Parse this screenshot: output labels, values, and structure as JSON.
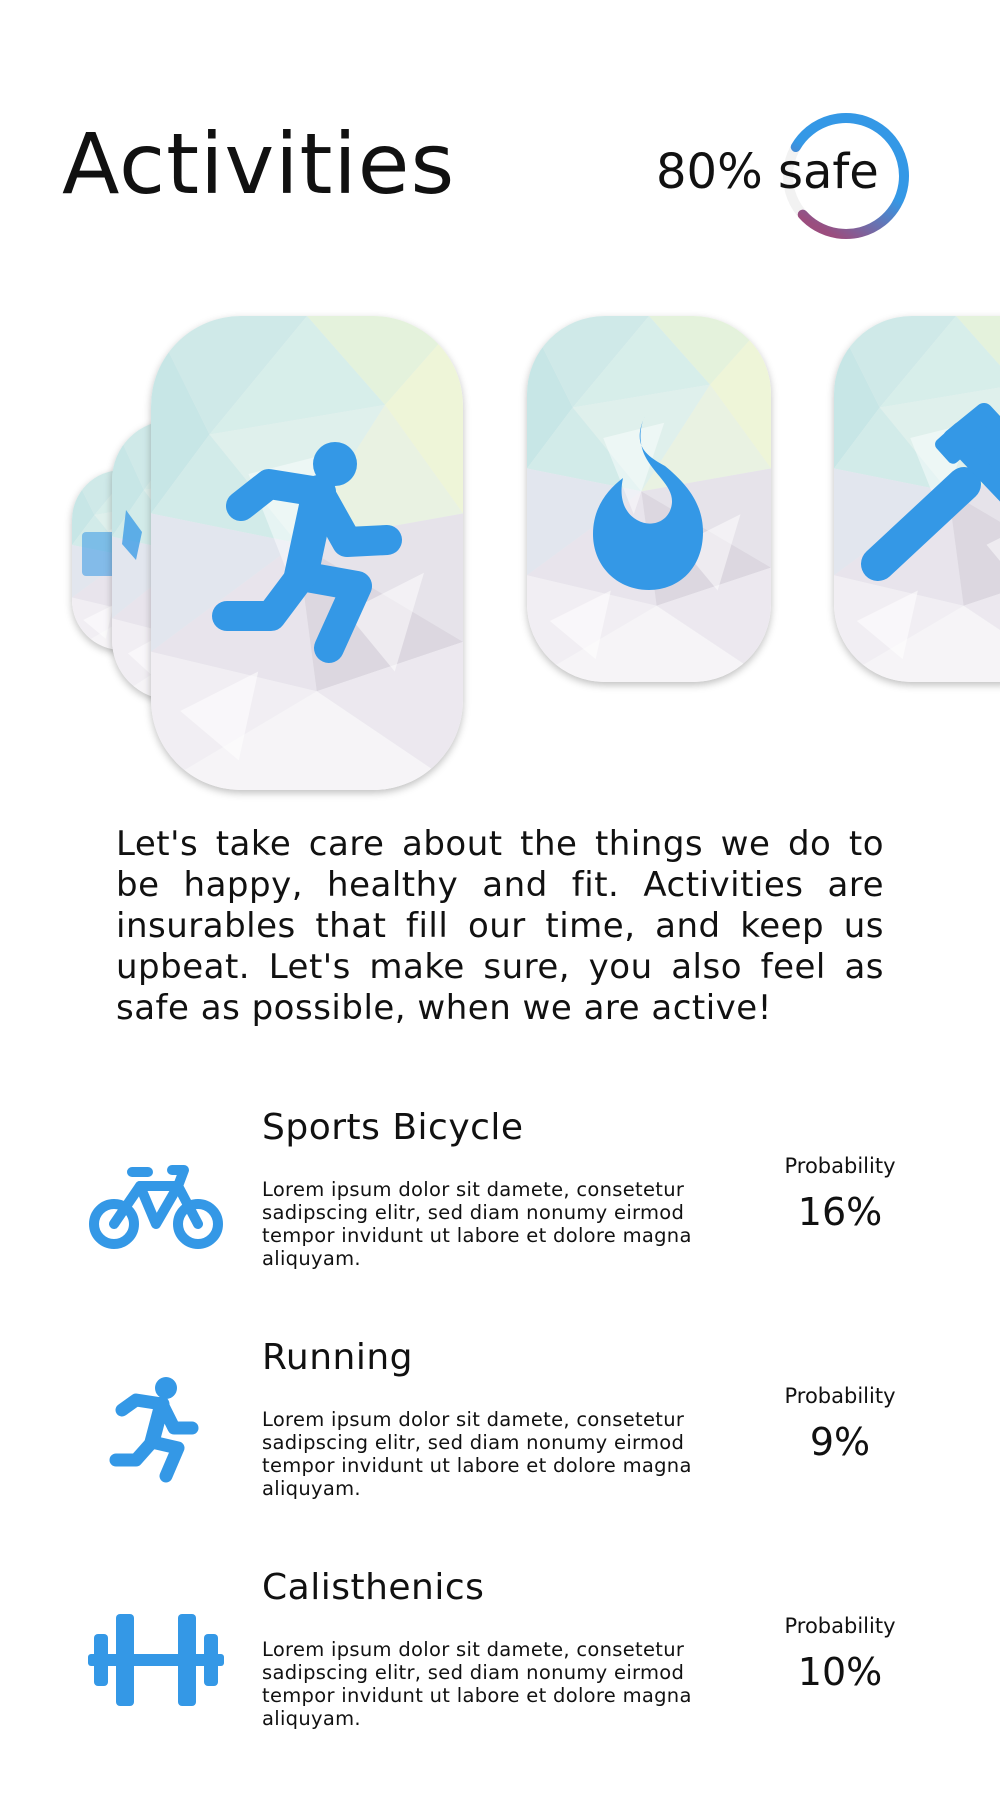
{
  "header": {
    "title": "Activities",
    "safety_value": 0.8,
    "safety_text": "80% safe"
  },
  "carousel": {
    "cards": [
      {
        "icon": "box-icon",
        "state": "stacked"
      },
      {
        "icon": "star-icon",
        "state": "stacked"
      },
      {
        "icon": "running-person-icon",
        "state": "active"
      },
      {
        "icon": "flame-icon",
        "state": "inactive"
      },
      {
        "icon": "hammer-icon",
        "state": "inactive"
      }
    ]
  },
  "intro": "Let's take care about the things we do to be happy, healthy and fit. Activities are insurables that fill our time, and keep us upbeat. Let's make sure, you also feel as safe as possible, when we are active!",
  "activities": [
    {
      "name": "Sports Bicycle",
      "icon": "bicycle-icon",
      "description": "Lorem ipsum dolor sit damete, consetetur sadipscing elitr, sed diam nonumy eirmod tempor invidunt ut labore et dolore magna aliquyam.",
      "probability_label": "Probability",
      "probability": "16%"
    },
    {
      "name": "Running",
      "icon": "running-person-icon",
      "description": "Lorem ipsum dolor sit damete, consetetur sadipscing elitr, sed diam nonumy eirmod tempor invidunt ut labore et dolore magna aliquyam.",
      "probability_label": "Probability",
      "probability": "9%"
    },
    {
      "name": "Calisthenics",
      "icon": "dumbbell-icon",
      "description": "Lorem ipsum dolor sit damete, consetetur sadipscing elitr, sed diam nonumy eirmod tempor invidunt ut labore et dolore magna aliquyam.",
      "probability_label": "Probability",
      "probability": "10%"
    }
  ],
  "colors": {
    "accent": "#3498e6",
    "ring_start": "#9b4d7e",
    "ring_end": "#3498e6",
    "text": "#111111"
  }
}
